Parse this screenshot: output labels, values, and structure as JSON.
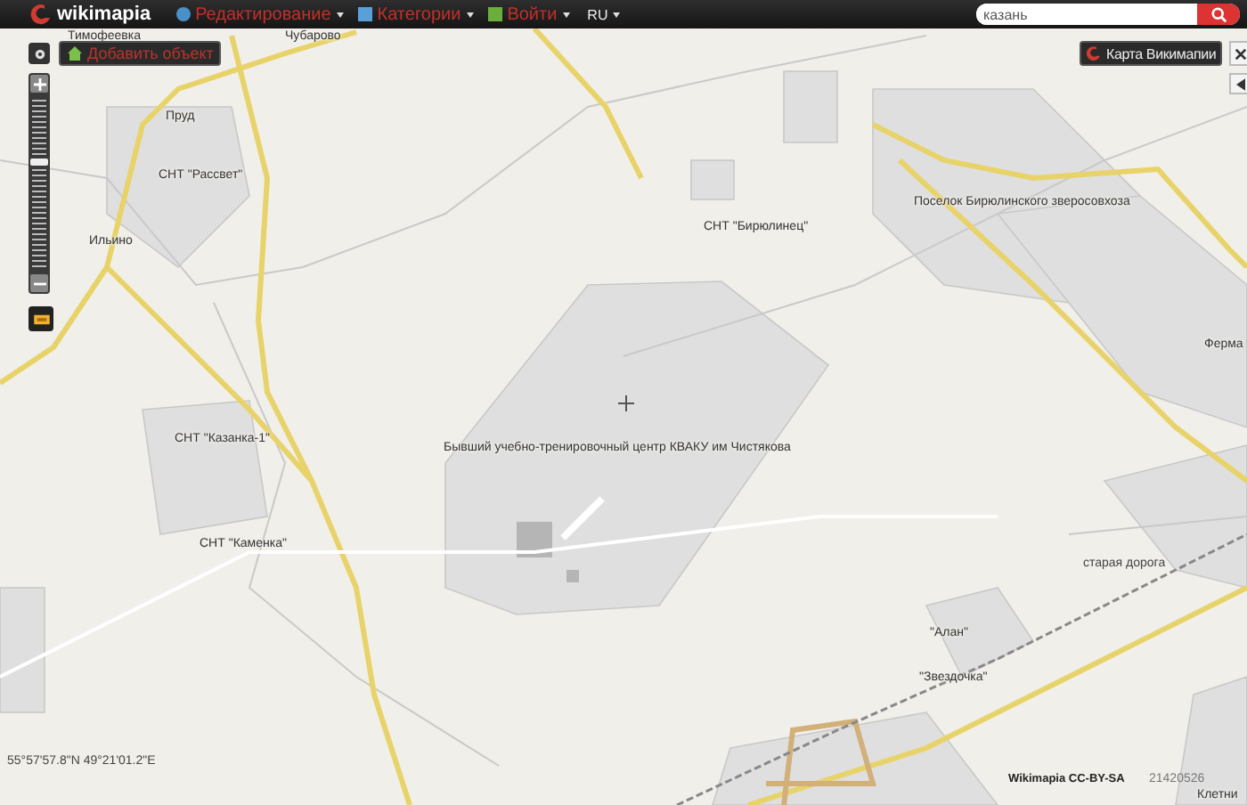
{
  "top_bar": {
    "logo": "wikimapia",
    "menu": [
      {
        "label": "Редактирование",
        "kind": "edit"
      },
      {
        "label": "Категории",
        "kind": "categories"
      },
      {
        "label": "Войти",
        "kind": "login"
      }
    ],
    "language": "RU",
    "search": {
      "value": "казань"
    }
  },
  "map_controls": {
    "add_object": "Добавить объект",
    "zoom": {
      "level": 0.62
    },
    "map_type": "Карта Викимапии"
  },
  "map_labels": [
    {
      "text": "Тимофеевка",
      "kind": "place"
    },
    {
      "text": "Чубарово",
      "kind": "place"
    },
    {
      "text": "Пруд",
      "kind": "place"
    },
    {
      "text": "СНТ \"Рассвет\"",
      "kind": "place"
    },
    {
      "text": "Ильино",
      "kind": "place"
    },
    {
      "text": "СНТ \"Бирюлинец\"",
      "kind": "place"
    },
    {
      "text": "Поселок Бирюлинского зверосовхоза",
      "kind": "place"
    },
    {
      "text": "Ферма",
      "kind": "place"
    },
    {
      "text": "Бывший учебно-тренировочный центр КВАКУ им Чистякова",
      "kind": "place"
    },
    {
      "text": "СНТ \"Казанка-1\"",
      "kind": "place"
    },
    {
      "text": "СНТ \"Каменка\"",
      "kind": "place"
    },
    {
      "text": "старая дорога",
      "kind": "road"
    },
    {
      "text": "\"Алан\"",
      "kind": "place"
    },
    {
      "text": "\"Звездочка\"",
      "kind": "place"
    },
    {
      "text": "Клетни",
      "kind": "place"
    }
  ],
  "status": {
    "coordinates": "55°57'57.8\"N 49°21'01.2\"E",
    "attribution": "Wikimapia CC-BY-SA",
    "date": "21420526"
  }
}
